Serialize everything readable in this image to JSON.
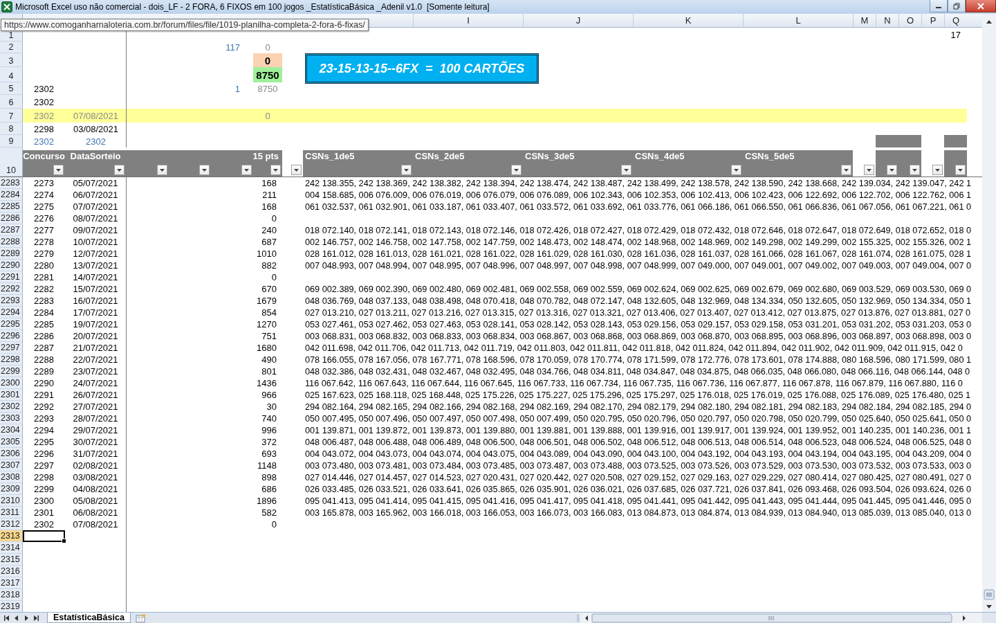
{
  "window": {
    "title": "Microsoft Excel uso não comercial - dois_LF - 2 FORA, 6 FIXOS em 100 jogos _EstatísticaBásica _Adenil v1.0  [Somente leitura]"
  },
  "tooltip": {
    "url": "https://www.comoganharnaloteria.com.br/forum/files/file/1019-planilha-completa-2-fora-6-fixas/"
  },
  "column_headers": [
    "I",
    "J",
    "K",
    "L",
    "M",
    "N",
    "O",
    "P",
    "Q"
  ],
  "top_rows": [
    {
      "row": "1",
      "highlighted": false,
      "cells": {
        "column_q": {
          "text": "17",
          "kind": "plain"
        }
      }
    },
    {
      "row": "2",
      "highlighted": false,
      "cells": {
        "column_e": {
          "text": "117",
          "kind": "blue"
        },
        "pts": {
          "text": "0",
          "kind": "gray"
        }
      }
    },
    {
      "row": "3",
      "highlighted": false,
      "cells": {
        "pts": {
          "text": "0",
          "kind": "peach"
        }
      }
    },
    {
      "row": "4",
      "highlighted": false,
      "cells": {
        "pts": {
          "text": "8750",
          "kind": "green"
        }
      }
    },
    {
      "row": "5",
      "highlighted": false,
      "cells": {
        "concurso": {
          "text": "2302",
          "kind": "plain"
        },
        "column_e": {
          "text": "1",
          "kind": "blue"
        },
        "pts": {
          "text": "8750",
          "kind": "gray"
        }
      }
    },
    {
      "row": "6",
      "highlighted": false,
      "cells": {
        "concurso": {
          "text": "2302",
          "kind": "plain"
        }
      }
    },
    {
      "row": "7",
      "highlighted": true,
      "cells": {
        "concurso": {
          "text": "2302",
          "kind": "gray"
        },
        "data": {
          "text": "07/08/2021",
          "kind": "gray"
        },
        "pts": {
          "text": "0",
          "kind": "gray"
        }
      }
    },
    {
      "row": "8",
      "highlighted": false,
      "cells": {
        "concurso": {
          "text": "2298",
          "kind": "plain"
        },
        "data": {
          "text": "03/08/2021",
          "kind": "plain"
        }
      }
    },
    {
      "row": "9",
      "highlighted": false,
      "cells": {
        "concurso": {
          "text": "2302",
          "kind": "blue"
        },
        "data": {
          "text": "2302",
          "kind": "blue"
        }
      }
    }
  ],
  "banner": {
    "text": "23-15-13-15--6FX  =  100 CARTÕES"
  },
  "header_row": {
    "row": "10",
    "concurso": "Concurso",
    "data": "DataSorteio",
    "pts": "15 pts",
    "csns": [
      "CSNs_1de5",
      "CSNs_2de5",
      "CSNs_3de5",
      "CSNs_4de5",
      "CSNs_5de5"
    ]
  },
  "rows": [
    {
      "row": "2283",
      "concurso": "2273",
      "data": "05/07/2021",
      "pts": "168",
      "csns": "242 138.355, 242 138.369, 242 138.382, 242 138.394, 242 138.474, 242 138.487, 242 138.499, 242 138.578, 242 138.590, 242 138.668, 242 139.034, 242 139.047, 242 1"
    },
    {
      "row": "2284",
      "concurso": "2274",
      "data": "06/07/2021",
      "pts": "211",
      "csns": "004 158.685, 006 076.009, 006 076.019, 006 076.079, 006 076.089, 006 102.343, 006 102.353, 006 102.413, 006 102.423, 006 122.692, 006 122.702, 006 122.762, 006 1"
    },
    {
      "row": "2285",
      "concurso": "2275",
      "data": "07/07/2021",
      "pts": "168",
      "csns": "061 032.537, 061 032.901, 061 033.187, 061 033.407, 061 033.572, 061 033.692, 061 033.776, 061 066.186, 061 066.550, 061 066.836, 061 067.056, 061 067.221, 061 0"
    },
    {
      "row": "2286",
      "concurso": "2276",
      "data": "08/07/2021",
      "pts": "0"
    },
    {
      "row": "2287",
      "concurso": "2277",
      "data": "09/07/2021",
      "pts": "240",
      "csns": "018 072.140, 018 072.141, 018 072.143, 018 072.146, 018 072.426, 018 072.427, 018 072.429, 018 072.432, 018 072.646, 018 072.647, 018 072.649, 018 072.652, 018 0"
    },
    {
      "row": "2288",
      "concurso": "2278",
      "data": "10/07/2021",
      "pts": "687",
      "csns": "002 146.757, 002 146.758, 002 147.758, 002 147.759, 002 148.473, 002 148.474, 002 148.968, 002 148.969, 002 149.298, 002 149.299, 002 155.325, 002 155.326, 002 1"
    },
    {
      "row": "2289",
      "concurso": "2279",
      "data": "12/07/2021",
      "pts": "1010",
      "csns": "028 161.012, 028 161.013, 028 161.021, 028 161.022, 028 161.029, 028 161.030, 028 161.036, 028 161.037, 028 161.066, 028 161.067, 028 161.074, 028 161.075, 028 1"
    },
    {
      "row": "2290",
      "concurso": "2280",
      "data": "13/07/2021",
      "pts": "882",
      "csns": "007 048.993, 007 048.994, 007 048.995, 007 048.996, 007 048.997, 007 048.998, 007 048.999, 007 049.000, 007 049.001, 007 049.002, 007 049.003, 007 049.004, 007 0"
    },
    {
      "row": "2291",
      "concurso": "2281",
      "data": "14/07/2021",
      "pts": "0"
    },
    {
      "row": "2292",
      "concurso": "2282",
      "data": "15/07/2021",
      "pts": "670",
      "csns": "069 002.389, 069 002.390, 069 002.480, 069 002.481, 069 002.558, 069 002.559, 069 002.624, 069 002.625, 069 002.679, 069 002.680, 069 003.529, 069 003.530, 069 0"
    },
    {
      "row": "2293",
      "concurso": "2283",
      "data": "16/07/2021",
      "pts": "1679",
      "csns": "048 036.769, 048 037.133, 048 038.498, 048 070.418, 048 070.782, 048 072.147, 048 132.605, 048 132.969, 048 134.334, 050 132.605, 050 132.969, 050 134.334, 050 1"
    },
    {
      "row": "2294",
      "concurso": "2284",
      "data": "17/07/2021",
      "pts": "854",
      "csns": "027 013.210, 027 013.211, 027 013.216, 027 013.315, 027 013.316, 027 013.321, 027 013.406, 027 013.407, 027 013.412, 027 013.875, 027 013.876, 027 013.881, 027 0"
    },
    {
      "row": "2295",
      "concurso": "2285",
      "data": "19/07/2021",
      "pts": "1270",
      "csns": "053 027.461, 053 027.462, 053 027.463, 053 028.141, 053 028.142, 053 028.143, 053 029.156, 053 029.157, 053 029.158, 053 031.201, 053 031.202, 053 031.203, 053 0"
    },
    {
      "row": "2296",
      "concurso": "2286",
      "data": "20/07/2021",
      "pts": "751",
      "csns": "003 068.831, 003 068.832, 003 068.833, 003 068.834, 003 068.867, 003 068.868, 003 068.869, 003 068.870, 003 068.895, 003 068.896, 003 068.897, 003 068.898, 003 0"
    },
    {
      "row": "2297",
      "concurso": "2287",
      "data": "21/07/2021",
      "pts": "1680",
      "csns": "042 011.698, 042 011.706, 042 011.713, 042 011.719, 042 011.803, 042 011.811, 042 011.818, 042 011.824, 042 011.894, 042 011.902, 042 011.909, 042 011.915, 042 0"
    },
    {
      "row": "2298",
      "concurso": "2288",
      "data": "22/07/2021",
      "pts": "490",
      "csns": "078 166.055, 078 167.056, 078 167.771, 078 168.596, 078 170.059, 078 170.774, 078 171.599, 078 172.776, 078 173.601, 078 174.888, 080 168.596, 080 171.599, 080 1"
    },
    {
      "row": "2299",
      "concurso": "2289",
      "data": "23/07/2021",
      "pts": "801",
      "csns": "048 032.386, 048 032.431, 048 032.467, 048 032.495, 048 034.766, 048 034.811, 048 034.847, 048 034.875, 048 066.035, 048 066.080, 048 066.116, 048 066.144, 048 0"
    },
    {
      "row": "2300",
      "concurso": "2290",
      "data": "24/07/2021",
      "pts": "1436",
      "csns": "116 067.642, 116 067.643, 116 067.644, 116 067.645, 116 067.733, 116 067.734, 116 067.735, 116 067.736, 116 067.877, 116 067.878, 116 067.879, 116 067.880, 116 0"
    },
    {
      "row": "2301",
      "concurso": "2291",
      "data": "26/07/2021",
      "pts": "966",
      "csns": "025 167.623, 025 168.118, 025 168.448, 025 175.226, 025 175.227, 025 175.296, 025 175.297, 025 176.018, 025 176.019, 025 176.088, 025 176.089, 025 176.480, 025 1"
    },
    {
      "row": "2302",
      "concurso": "2292",
      "data": "27/07/2021",
      "pts": "30",
      "csns": "294 082.164, 294 082.165, 294 082.166, 294 082.168, 294 082.169, 294 082.170, 294 082.179, 294 082.180, 294 082.181, 294 082.183, 294 082.184, 294 082.185, 294 0"
    },
    {
      "row": "2303",
      "concurso": "2293",
      "data": "28/07/2021",
      "pts": "740",
      "csns": "050 007.495, 050 007.496, 050 007.497, 050 007.498, 050 007.499, 050 020.795, 050 020.796, 050 020.797, 050 020.798, 050 020.799, 050 025.640, 050 025.641, 050 0"
    },
    {
      "row": "2304",
      "concurso": "2294",
      "data": "29/07/2021",
      "pts": "996",
      "csns": "001 139.871, 001 139.872, 001 139.873, 001 139.880, 001 139.881, 001 139.888, 001 139.916, 001 139.917, 001 139.924, 001 139.952, 001 140.235, 001 140.236, 001 1"
    },
    {
      "row": "2305",
      "concurso": "2295",
      "data": "30/07/2021",
      "pts": "372",
      "csns": "048 006.487, 048 006.488, 048 006.489, 048 006.500, 048 006.501, 048 006.502, 048 006.512, 048 006.513, 048 006.514, 048 006.523, 048 006.524, 048 006.525, 048 0"
    },
    {
      "row": "2306",
      "concurso": "2296",
      "data": "31/07/2021",
      "pts": "693",
      "csns": "004 043.072, 004 043.073, 004 043.074, 004 043.075, 004 043.089, 004 043.090, 004 043.100, 004 043.192, 004 043.193, 004 043.194, 004 043.195, 004 043.209, 004 0"
    },
    {
      "row": "2307",
      "concurso": "2297",
      "data": "02/08/2021",
      "pts": "1148",
      "csns": "003 073.480, 003 073.481, 003 073.484, 003 073.485, 003 073.487, 003 073.488, 003 073.525, 003 073.526, 003 073.529, 003 073.530, 003 073.532, 003 073.533, 003 0"
    },
    {
      "row": "2308",
      "concurso": "2298",
      "data": "03/08/2021",
      "pts": "898",
      "csns": "027 014.446, 027 014.457, 027 014.523, 027 020.431, 027 020.442, 027 020.508, 027 029.152, 027 029.163, 027 029.229, 027 080.414, 027 080.425, 027 080.491, 027 0"
    },
    {
      "row": "2309",
      "concurso": "2299",
      "data": "04/08/2021",
      "pts": "686",
      "csns": "026 033.485, 026 033.521, 026 033.641, 026 035.865, 026 035.901, 026 036.021, 026 037.685, 026 037.721, 026 037.841, 026 093.468, 026 093.504, 026 093.624, 026 0"
    },
    {
      "row": "2310",
      "concurso": "2300",
      "data": "05/08/2021",
      "pts": "1896",
      "csns": "095 041.413, 095 041.414, 095 041.415, 095 041.416, 095 041.417, 095 041.418, 095 041.441, 095 041.442, 095 041.443, 095 041.444, 095 041.445, 095 041.446, 095 0"
    },
    {
      "row": "2311",
      "concurso": "2301",
      "data": "06/08/2021",
      "pts": "582",
      "csns": "003 165.878, 003 165.962, 003 166.018, 003 166.053, 003 166.073, 003 166.083, 013 084.873, 013 084.874, 013 084.939, 013 084.940, 013 085.039, 013 085.040, 013 0"
    },
    {
      "row": "2312",
      "concurso": "2302",
      "data": "07/08/2021",
      "pts": "0"
    }
  ],
  "empty_rows": [
    {
      "row": "2313",
      "selected": true
    },
    {
      "row": "2314",
      "selected": false
    },
    {
      "row": "2315",
      "selected": false
    },
    {
      "row": "2316",
      "selected": false
    },
    {
      "row": "2317",
      "selected": false
    },
    {
      "row": "2318",
      "selected": false
    },
    {
      "row": "2319",
      "selected": false
    }
  ],
  "sheet_tabs": [
    {
      "label": "EstatísticaBásica",
      "selected": true
    }
  ]
}
